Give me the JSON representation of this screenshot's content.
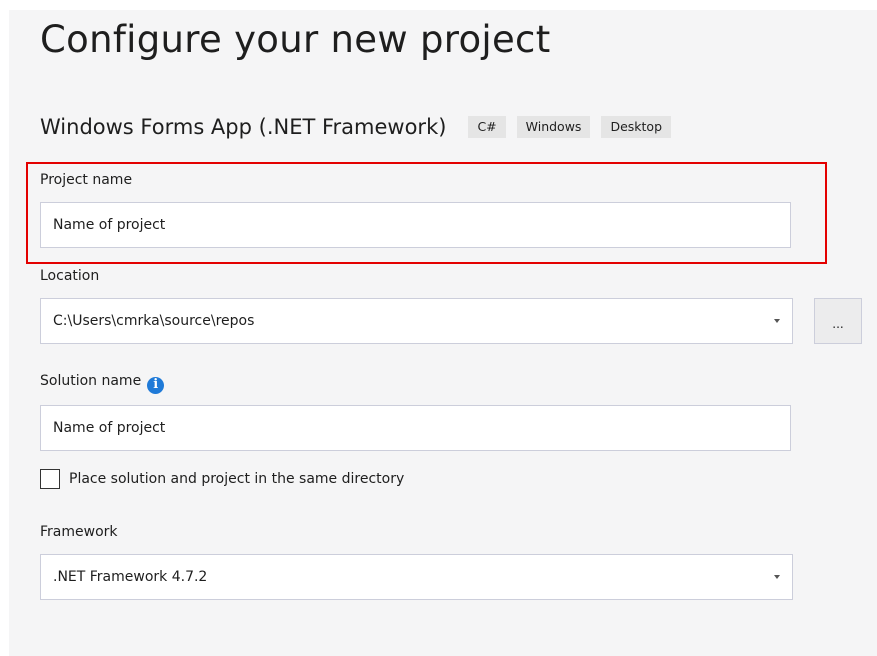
{
  "page": {
    "title": "Configure your new project"
  },
  "template": {
    "name": "Windows Forms App (.NET Framework)",
    "tags": [
      "C#",
      "Windows",
      "Desktop"
    ]
  },
  "project_name": {
    "label": "Project name",
    "value": "Name of project"
  },
  "location": {
    "label": "Location",
    "value": "C:\\Users\\cmrka\\source\\repos",
    "browse_label": "..."
  },
  "solution_name": {
    "label": "Solution name",
    "info_icon": "i",
    "value": "Name of project"
  },
  "same_directory": {
    "label": "Place solution and project in the same directory",
    "checked": false
  },
  "framework": {
    "label": "Framework",
    "value": ".NET Framework 4.7.2"
  },
  "colors": {
    "highlight": "#e30000",
    "info_icon": "#1f7ad8",
    "panel_background": "#f5f5f6"
  }
}
